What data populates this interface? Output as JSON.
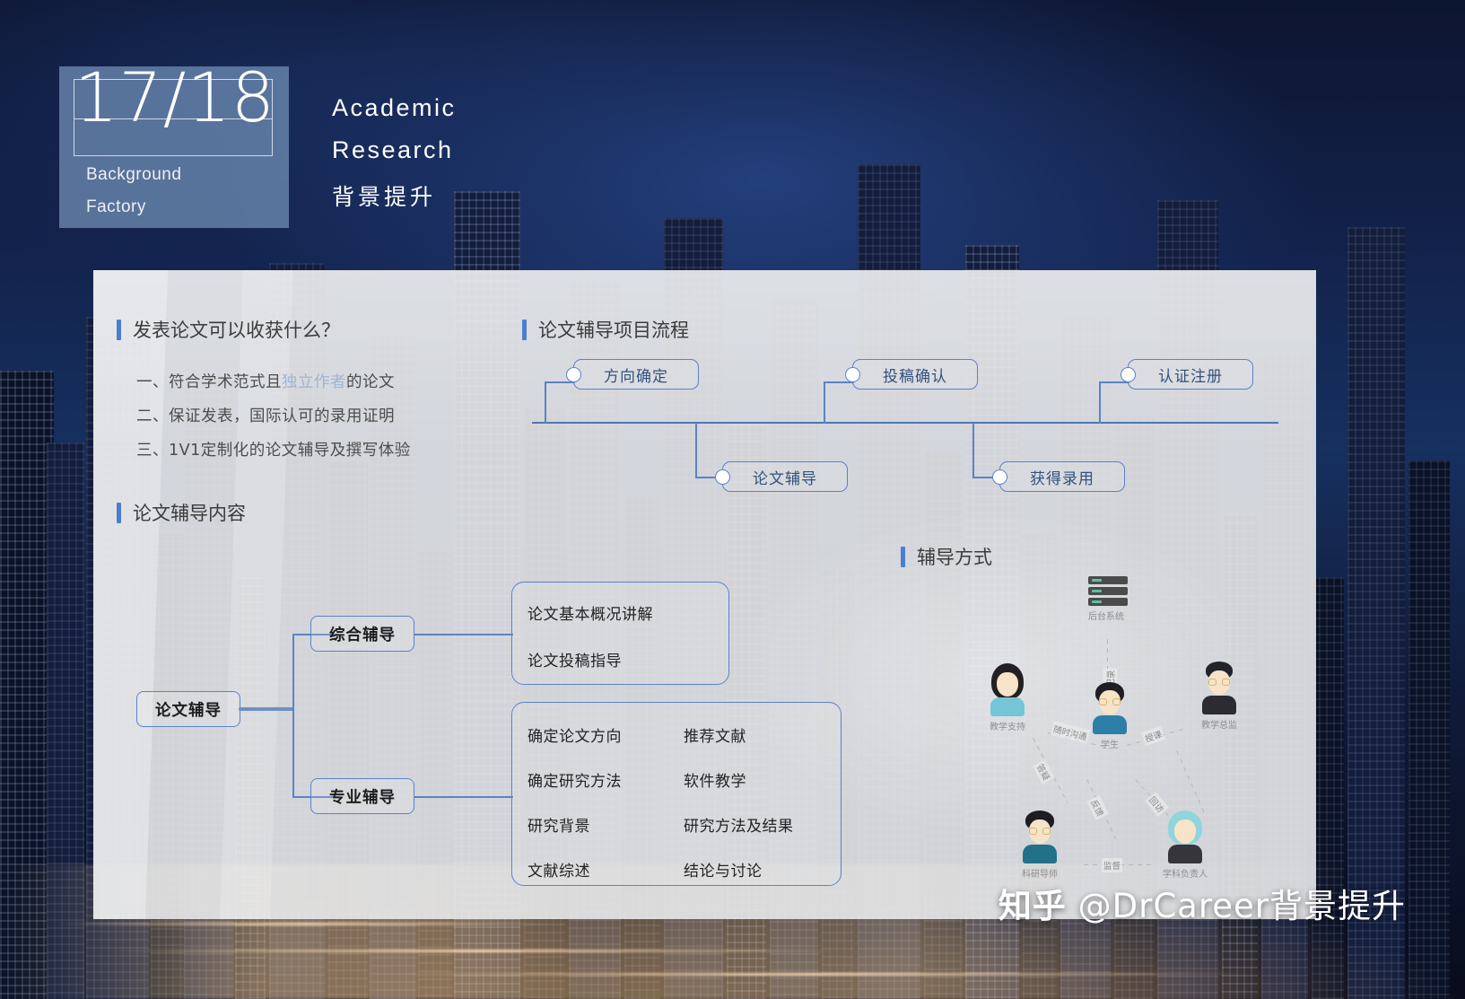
{
  "header": {
    "page_number": "17/18",
    "card_line1": "Background",
    "card_line2": "Factory",
    "en_line1": "Academic",
    "en_line2": "Research",
    "cn_title": "背景提升"
  },
  "left_section": {
    "heading": "发表论文可以收获什么？",
    "bullets": [
      {
        "prefix": "一、符合学术范式且",
        "highlight": "独立作者",
        "suffix": "的论文"
      },
      {
        "prefix": "二、保证发表，国际认可的录用证明",
        "highlight": "",
        "suffix": ""
      },
      {
        "prefix": "三、1V1定制化的论文辅导及撰写体验",
        "highlight": "",
        "suffix": ""
      }
    ],
    "mindmap_heading": "论文辅导内容"
  },
  "flow_section": {
    "heading": "论文辅导项目流程",
    "top_nodes": [
      "方向确定",
      "投稿确认",
      "认证注册"
    ],
    "bottom_nodes": [
      "论文辅导",
      "获得录用"
    ]
  },
  "mindmap": {
    "root": "论文辅导",
    "branch1": {
      "label": "综合辅导",
      "items": [
        "论文基本概况讲解",
        "论文投稿指导"
      ]
    },
    "branch2": {
      "label": "专业辅导",
      "col_left": [
        "确定论文方向",
        "确定研究方法",
        "研究背景",
        "文献综述"
      ],
      "col_right": [
        "推荐文献",
        "软件教学",
        "研究方法及结果",
        "结论与讨论"
      ]
    }
  },
  "people_section": {
    "heading": "辅导方式",
    "server_label": "后台系统",
    "center": "学生",
    "nodes": [
      {
        "name": "教学支持"
      },
      {
        "name": "教学总监"
      },
      {
        "name": "科研导师"
      },
      {
        "name": "学科负责人"
      }
    ],
    "edge_labels": [
      "记录",
      "随时沟通",
      "授课",
      "答疑",
      "反馈",
      "回访",
      "监督"
    ]
  },
  "watermark": {
    "logo": "知乎",
    "handle": "@DrCareer背景提升"
  },
  "colors": {
    "accent_blue": "#4a7fd0",
    "line_blue": "#5b82c9",
    "panel_bg": "#e8e9ea",
    "card_bg": "#7391b9"
  }
}
